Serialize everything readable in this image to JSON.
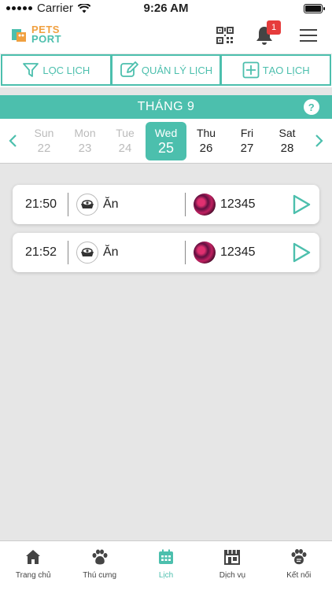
{
  "status": {
    "carrier": "Carrier",
    "time": "9:26 AM"
  },
  "header": {
    "logo_line1": "PETS",
    "logo_line2": "PORT",
    "notification_count": "1"
  },
  "actions": [
    {
      "label": "LỌC LỊCH",
      "icon": "filter-icon"
    },
    {
      "label": "QUẢN LÝ LỊCH",
      "icon": "edit-icon"
    },
    {
      "label": "TẠO LỊCH",
      "icon": "plus-square-icon"
    }
  ],
  "calendar": {
    "month_label": "THÁNG 9",
    "help": "?",
    "days": [
      {
        "name": "Sun",
        "date": "22"
      },
      {
        "name": "Mon",
        "date": "23"
      },
      {
        "name": "Tue",
        "date": "24"
      },
      {
        "name": "Wed",
        "date": "25"
      },
      {
        "name": "Thu",
        "date": "26"
      },
      {
        "name": "Fri",
        "date": "27"
      },
      {
        "name": "Sat",
        "date": "28"
      }
    ],
    "selected": "Wed"
  },
  "schedule": [
    {
      "time": "21:50",
      "activity": "Ăn",
      "pet": "12345"
    },
    {
      "time": "21:52",
      "activity": "Ăn",
      "pet": "12345"
    }
  ],
  "tabs": [
    {
      "label": "Trang chủ",
      "icon": "home-icon"
    },
    {
      "label": "Thú cưng",
      "icon": "paw-icon"
    },
    {
      "label": "Lịch",
      "icon": "calendar-icon"
    },
    {
      "label": "Dịch vụ",
      "icon": "store-icon"
    },
    {
      "label": "Kết nối",
      "icon": "chat-paw-icon"
    }
  ],
  "colors": {
    "accent": "#4cbfad",
    "badge": "#e63c3c",
    "logo_orange": "#f0a040"
  }
}
